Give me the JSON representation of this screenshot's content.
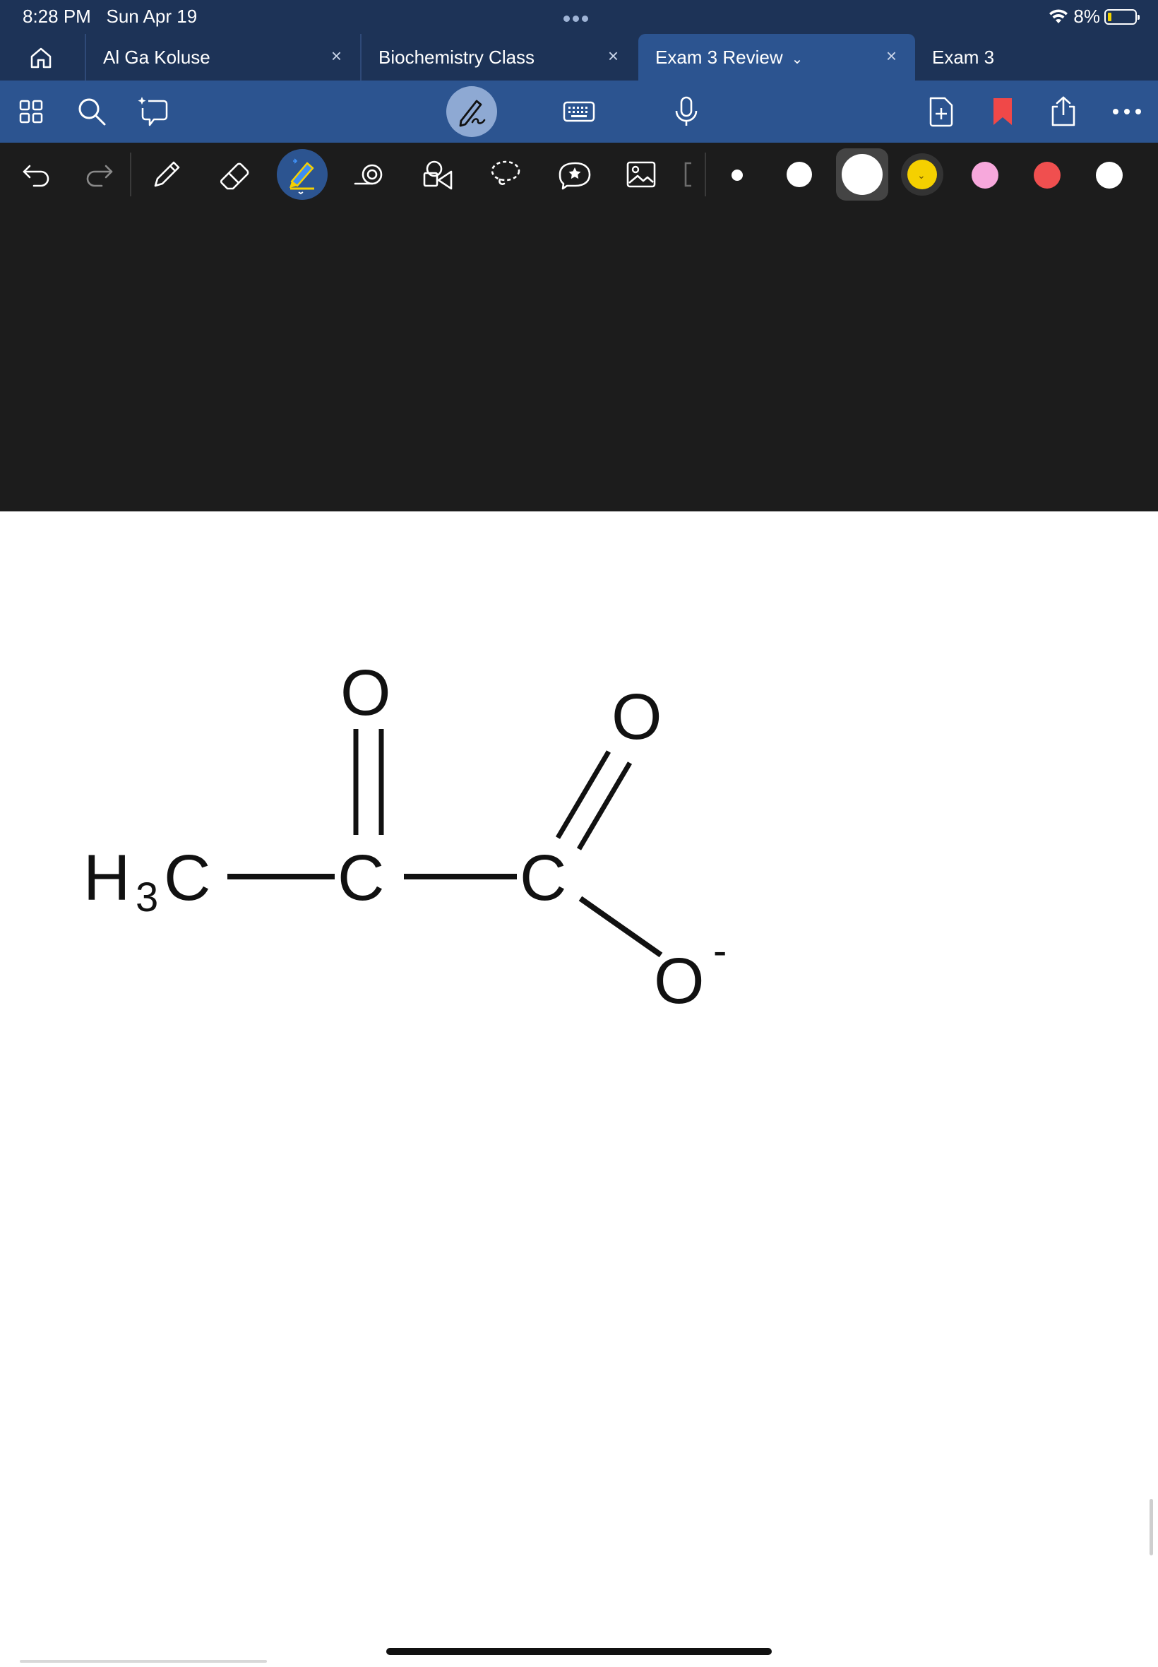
{
  "status": {
    "time": "8:28 PM",
    "date": "Sun Apr 19",
    "battery": "8%"
  },
  "tabs": [
    {
      "label": "Al Ga Koluse",
      "close": "×"
    },
    {
      "label": "Biochemistry Class",
      "close": "×"
    },
    {
      "label": "Exam 3 Review",
      "close": "×",
      "active": true
    },
    {
      "label": "Exam 3"
    }
  ],
  "toolbar": {
    "icons": [
      "home-icon",
      "grid-icon",
      "search-icon",
      "ai-lasso-icon",
      "pen-mode-icon",
      "keyboard-icon",
      "microphone-icon",
      "add-page-icon",
      "bookmark-icon",
      "share-icon",
      "more-icon"
    ]
  },
  "tools": {
    "icons": [
      "undo-icon",
      "redo-icon",
      "pencil-icon",
      "eraser-icon",
      "highlighter-icon",
      "shape-spiral-icon",
      "shapes-icon",
      "lasso-icon",
      "sticker-icon",
      "image-icon"
    ],
    "colors": [
      "#ffffff",
      "#ffffff",
      "#ffffff",
      "#f5d000",
      "#f7a8dc",
      "#f04f4f",
      "#ffffff"
    ],
    "accent": "#2c5490"
  },
  "molecule": {
    "methyl_h": "H",
    "methyl_sub": "3",
    "methyl_c": "C",
    "carbon_1": "C",
    "carbon_2": "C",
    "oxygen_1": "O",
    "oxygen_2": "O",
    "oxygen_3": "O",
    "charge": "-"
  }
}
